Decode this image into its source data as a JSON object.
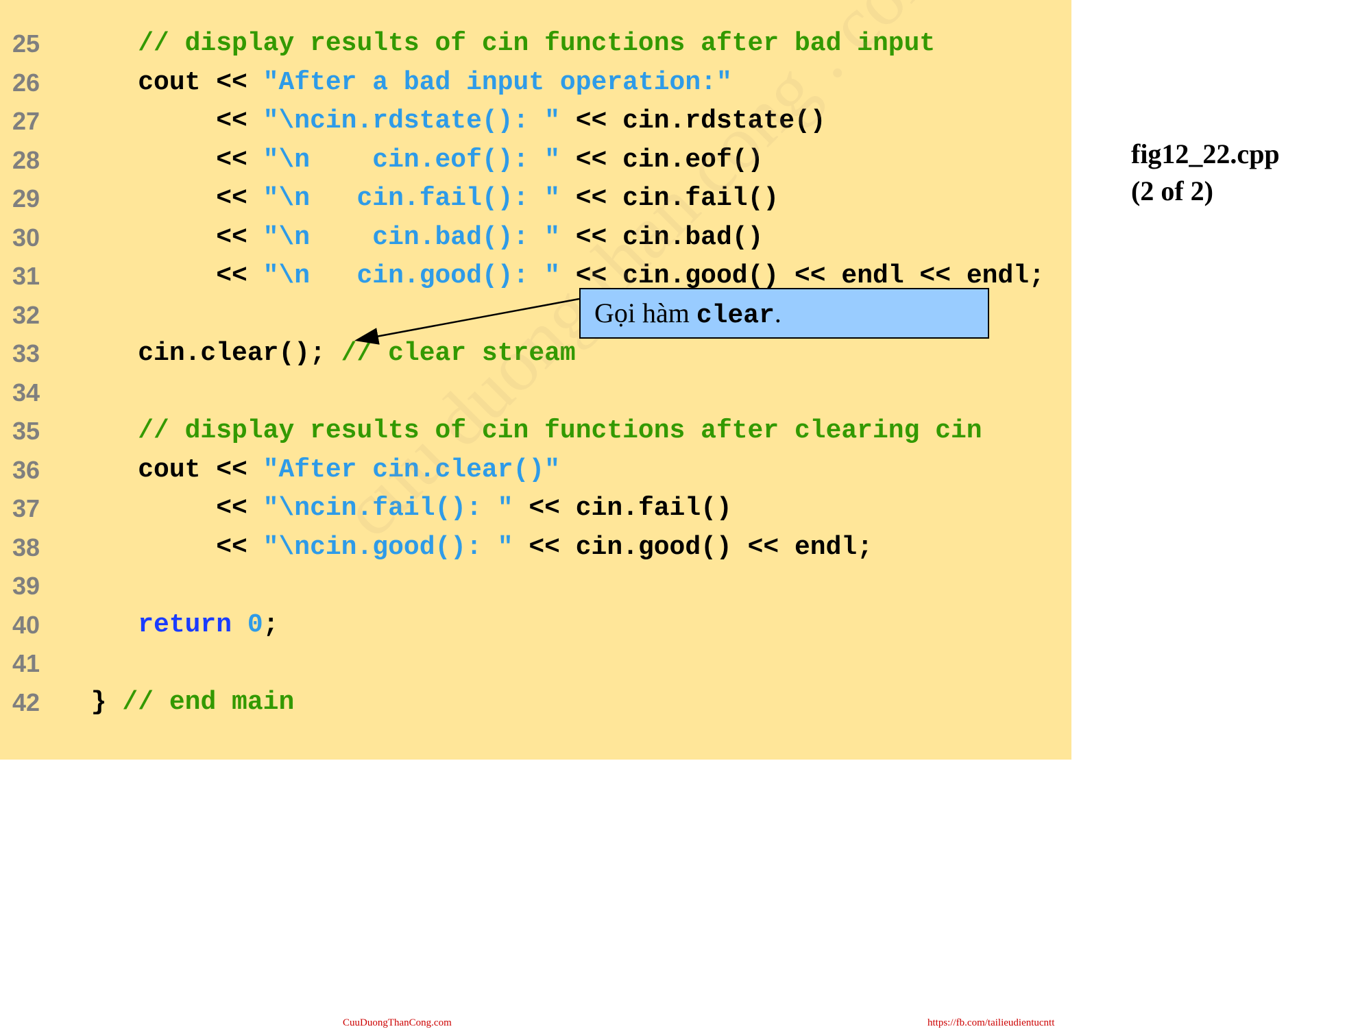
{
  "code_lines": [
    {
      "no": "25",
      "tokens": [
        {
          "t": "comment",
          "v": "    // display results of cin functions after bad input"
        }
      ]
    },
    {
      "no": "26",
      "tokens": [
        {
          "t": "plain",
          "v": "    cout << "
        },
        {
          "t": "string",
          "v": "\"After a bad input operation:\""
        }
      ]
    },
    {
      "no": "27",
      "tokens": [
        {
          "t": "plain",
          "v": "         << "
        },
        {
          "t": "string",
          "v": "\"\\ncin.rdstate(): \""
        },
        {
          "t": "plain",
          "v": " << cin.rdstate()"
        }
      ]
    },
    {
      "no": "28",
      "tokens": [
        {
          "t": "plain",
          "v": "         << "
        },
        {
          "t": "string",
          "v": "\"\\n    cin.eof(): \""
        },
        {
          "t": "plain",
          "v": " << cin.eof()"
        }
      ]
    },
    {
      "no": "29",
      "tokens": [
        {
          "t": "plain",
          "v": "         << "
        },
        {
          "t": "string",
          "v": "\"\\n   cin.fail(): \""
        },
        {
          "t": "plain",
          "v": " << cin.fail()"
        }
      ]
    },
    {
      "no": "30",
      "tokens": [
        {
          "t": "plain",
          "v": "         << "
        },
        {
          "t": "string",
          "v": "\"\\n    cin.bad(): \""
        },
        {
          "t": "plain",
          "v": " << cin.bad()"
        }
      ]
    },
    {
      "no": "31",
      "tokens": [
        {
          "t": "plain",
          "v": "         << "
        },
        {
          "t": "string",
          "v": "\"\\n   cin.good(): \""
        },
        {
          "t": "plain",
          "v": " << cin.good() << endl << endl;"
        }
      ]
    },
    {
      "no": "32",
      "tokens": []
    },
    {
      "no": "33",
      "tokens": [
        {
          "t": "plain",
          "v": "    cin.clear(); "
        },
        {
          "t": "comment",
          "v": "// clear stream"
        }
      ]
    },
    {
      "no": "34",
      "tokens": []
    },
    {
      "no": "35",
      "tokens": [
        {
          "t": "comment",
          "v": "    // display results of cin functions after clearing cin"
        }
      ]
    },
    {
      "no": "36",
      "tokens": [
        {
          "t": "plain",
          "v": "    cout << "
        },
        {
          "t": "string",
          "v": "\"After cin.clear()\""
        }
      ]
    },
    {
      "no": "37",
      "tokens": [
        {
          "t": "plain",
          "v": "         << "
        },
        {
          "t": "string",
          "v": "\"\\ncin.fail(): \""
        },
        {
          "t": "plain",
          "v": " << cin.fail()"
        }
      ]
    },
    {
      "no": "38",
      "tokens": [
        {
          "t": "plain",
          "v": "         << "
        },
        {
          "t": "string",
          "v": "\"\\ncin.good(): \""
        },
        {
          "t": "plain",
          "v": " << cin.good() << endl;"
        }
      ]
    },
    {
      "no": "39",
      "tokens": []
    },
    {
      "no": "40",
      "tokens": [
        {
          "t": "plain",
          "v": "    "
        },
        {
          "t": "keyword",
          "v": "return"
        },
        {
          "t": "plain",
          "v": " "
        },
        {
          "t": "number",
          "v": "0"
        },
        {
          "t": "plain",
          "v": ";"
        }
      ]
    },
    {
      "no": "41",
      "tokens": []
    },
    {
      "no": "42",
      "tokens": [
        {
          "t": "plain",
          "v": " } "
        },
        {
          "t": "comment",
          "v": "// end main"
        }
      ]
    }
  ],
  "fig_label": {
    "file": "fig12_22.cpp",
    "part": "(2 of 2)"
  },
  "callout": {
    "prefix": "Gọi hàm ",
    "code": "clear",
    "suffix": "."
  },
  "watermark": "cuu duong than cong . com",
  "footer": {
    "left": "CuuDuongThanCong.com",
    "right": "https://fb.com/tailieudientucntt"
  },
  "colors": {
    "panel_bg": "#ffe699",
    "comment": "#339900",
    "string": "#2e9be8",
    "keyword": "#1a3cff",
    "line_number": "#7f7f7f",
    "callout_bg": "#99ccff",
    "footer": "#cc0000"
  }
}
